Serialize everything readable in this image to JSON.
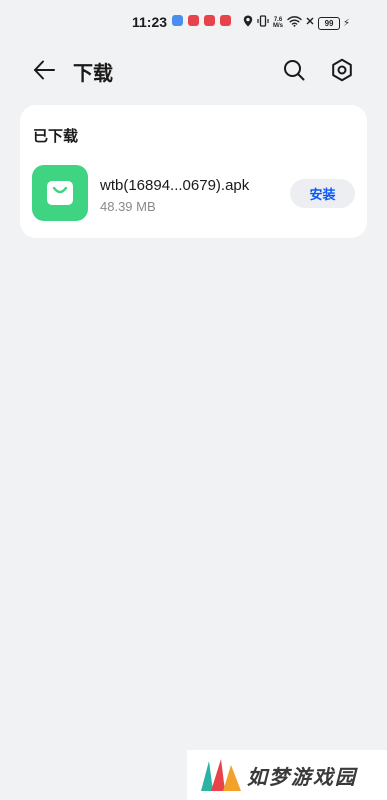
{
  "status_bar": {
    "time": "11:23",
    "net_speed_value": "7.6",
    "net_speed_unit": "M/s",
    "battery": "99",
    "notification_colors": [
      "#4a8df0",
      "#e8434b",
      "#e8434b",
      "#e8434b"
    ]
  },
  "header": {
    "title": "下载",
    "back_icon": "arrow-left-icon",
    "search_icon": "search-icon",
    "settings_icon": "gear-icon"
  },
  "downloaded": {
    "section_title": "已下载",
    "items": [
      {
        "file_name": "wtb(16894...0679).apk",
        "file_size": "48.39 MB",
        "action_label": "安装",
        "icon": "shopping-bag-icon",
        "icon_color": "#3ed482"
      }
    ]
  },
  "watermark": {
    "text": "如梦游戏园",
    "logo_colors": [
      "#2bb3a3",
      "#e8434b",
      "#f2a12b"
    ]
  },
  "colors": {
    "background": "#f1f2f4",
    "accent": "#0a59f7"
  }
}
